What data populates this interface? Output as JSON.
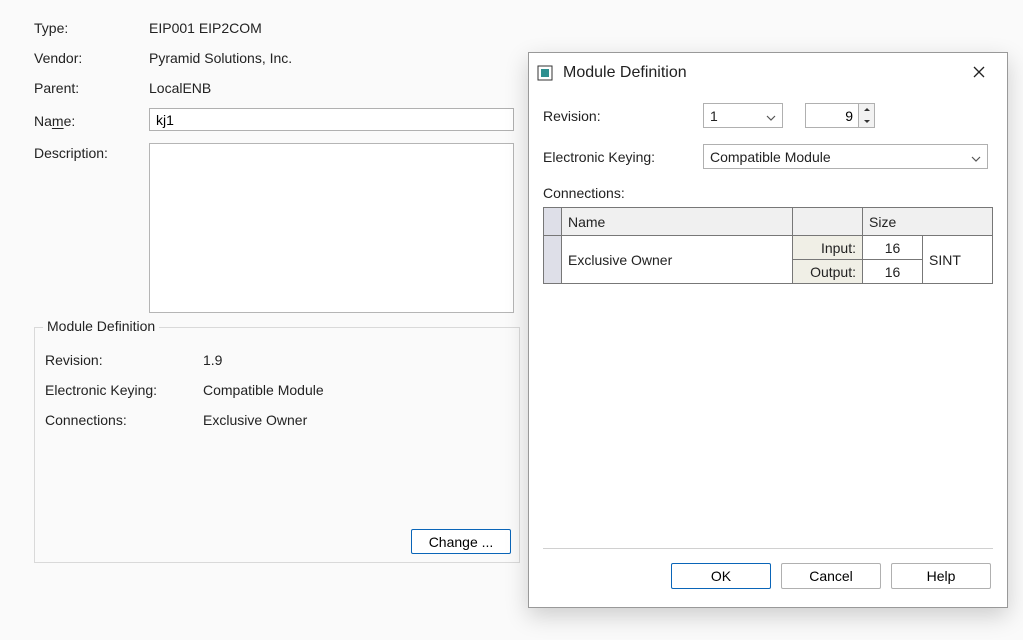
{
  "general": {
    "type_label": "Type:",
    "type_value": "EIP001 EIP2COM",
    "vendor_label": "Vendor:",
    "vendor_value": "Pyramid Solutions, Inc.",
    "parent_label": "Parent:",
    "parent_value": "LocalENB",
    "name_label_pre": "Na",
    "name_label_u": "m",
    "name_label_post": "e:",
    "name_value": "kj1",
    "desc_label": "Description:",
    "desc_value": ""
  },
  "mod_def": {
    "legend": "Module Definition",
    "revision_label": "Revision:",
    "revision_value": "1.9",
    "ek_label": "Electronic Keying:",
    "ek_value": "Compatible Module",
    "conn_label": "Connections:",
    "conn_value": "Exclusive Owner",
    "change_btn": "Change ..."
  },
  "dialog": {
    "title": "Module Definition",
    "revision_label": "Revision:",
    "revision_major": "1",
    "revision_minor": "9",
    "ek_label": "Electronic Keying:",
    "ek_value": "Compatible Module",
    "connections_label": "Connections:",
    "tbl": {
      "name_header": "Name",
      "size_header": "Size",
      "row": {
        "name": "Exclusive Owner",
        "input_label": "Input:",
        "input_size": "16",
        "output_label": "Output:",
        "output_size": "16",
        "data_type": "SINT"
      }
    },
    "ok": "OK",
    "cancel": "Cancel",
    "help": "Help"
  }
}
